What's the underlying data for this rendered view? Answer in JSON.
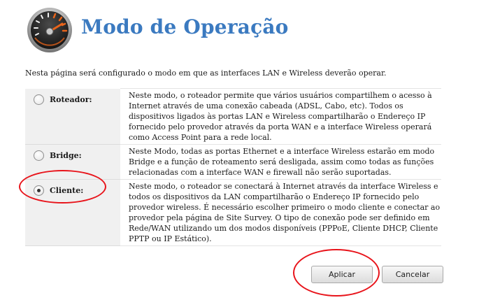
{
  "header": {
    "title": "Modo de Operação",
    "icon": "speedometer-icon"
  },
  "intro": "Nesta página será configurado o modo em que as interfaces LAN e Wireless deverão operar.",
  "modes": [
    {
      "label": "Roteador:",
      "selected": false,
      "description": "Neste modo, o roteador permite que vários usuários compartilhem o acesso à Internet através de uma conexão cabeada (ADSL, Cabo, etc). Todos os dispositivos ligados às portas LAN e Wireless compartilharão o Endereço IP fornecido pelo provedor através da porta WAN e a interface Wireless operará como Access Point para a rede local."
    },
    {
      "label": "Bridge:",
      "selected": false,
      "description": "Neste Modo, todas as portas Ethernet e a interface Wireless estarão em modo Bridge e a função de roteamento será desligada, assim como todas as funções relacionadas com a interface WAN e firewall não serão suportadas."
    },
    {
      "label": "Cliente:",
      "selected": true,
      "description": "Neste modo, o roteador se conectará à Internet através da interface Wireless e todos os dispositivos da LAN compartilharão o Endereço IP fornecido pelo provedor wireless. É necessário escolher primeiro o modo cliente e conectar ao provedor pela página de Site Survey. O tipo de conexão pode ser definido em Rede/WAN utilizando um dos modos disponíveis (PPPoE, Cliente DHCP, Cliente PPTP ou IP Estático)."
    }
  ],
  "buttons": {
    "apply": "Aplicar",
    "cancel": "Cancelar"
  },
  "colors": {
    "title": "#3b7ac0",
    "annotation": "#e8141b"
  }
}
